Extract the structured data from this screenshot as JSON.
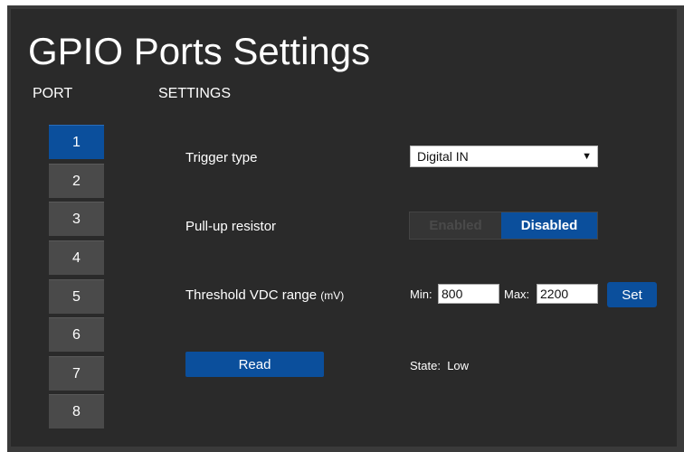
{
  "title": "GPIO Ports Settings",
  "columns": {
    "port": "PORT",
    "settings": "SETTINGS"
  },
  "ports": [
    "1",
    "2",
    "3",
    "4",
    "5",
    "6",
    "7",
    "8"
  ],
  "selected_port": "1",
  "trigger": {
    "label": "Trigger type",
    "value": "Digital IN"
  },
  "pullup": {
    "label": "Pull-up resistor",
    "enabled": "Enabled",
    "disabled": "Disabled",
    "selected": "Disabled"
  },
  "threshold": {
    "label": "Threshold VDC range",
    "unit": "(mV)",
    "min_label": "Min:",
    "min_value": "800",
    "max_label": "Max:",
    "max_value": "2200",
    "set_label": "Set"
  },
  "read": {
    "button_label": "Read",
    "state_label": "State:",
    "state_value": "Low"
  },
  "colors": {
    "accent": "#0b4f9c",
    "background": "#2a2a2a",
    "port_button": "#4a4a4a"
  }
}
